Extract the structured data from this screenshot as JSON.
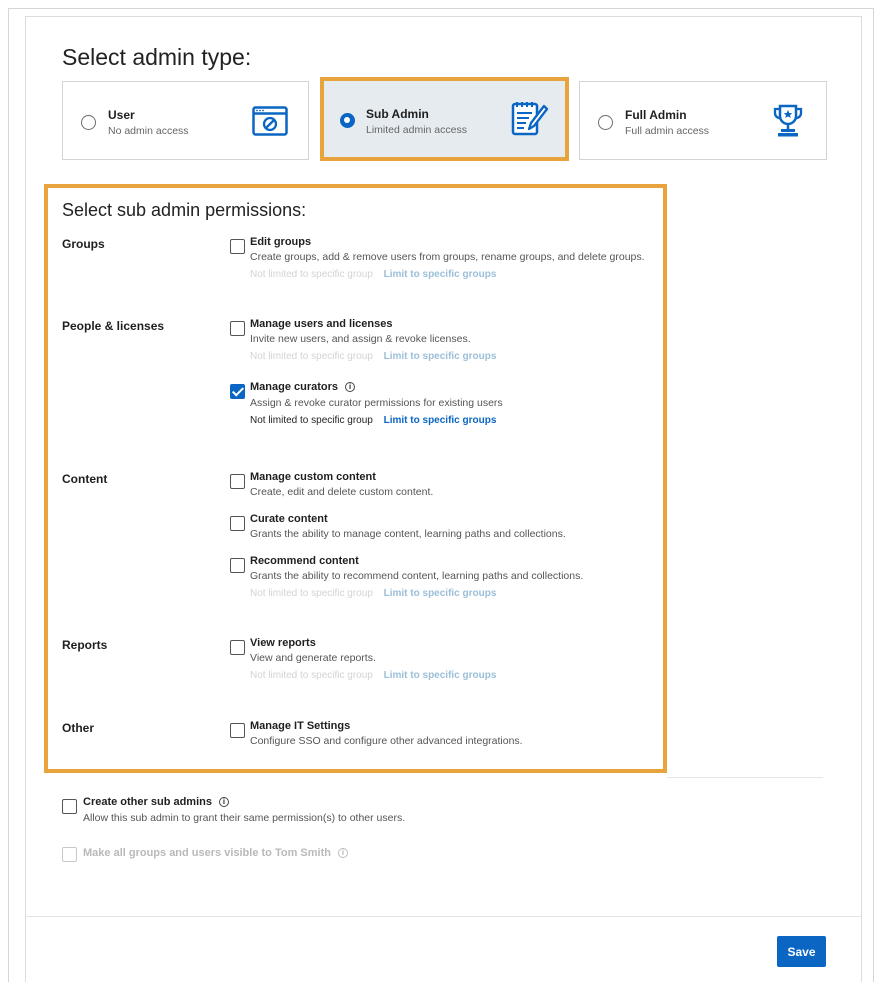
{
  "admin_type": {
    "heading": "Select admin type:",
    "options": [
      {
        "title": "User",
        "subtitle": "No admin access",
        "icon": "browser-blocked-icon",
        "selected": false
      },
      {
        "title": "Sub Admin",
        "subtitle": "Limited admin access",
        "icon": "notepad-edit-icon",
        "selected": true
      },
      {
        "title": "Full Admin",
        "subtitle": "Full admin access",
        "icon": "trophy-icon",
        "selected": false
      }
    ]
  },
  "permissions": {
    "heading": "Select sub admin permissions:",
    "sections": {
      "groups": "Groups",
      "people": "People & licenses",
      "content": "Content",
      "reports": "Reports",
      "other": "Other"
    },
    "items": {
      "edit_groups": {
        "title": "Edit groups",
        "desc": "Create groups, add & remove users from groups, rename groups, and delete groups.",
        "checked": false
      },
      "manage_users": {
        "title": "Manage users and licenses",
        "desc": "Invite new users, and assign & revoke licenses.",
        "checked": false
      },
      "manage_curators": {
        "title": "Manage curators",
        "desc": "Assign & revoke curator permissions for existing users",
        "checked": true
      },
      "manage_custom": {
        "title": "Manage custom content",
        "desc": "Create, edit and delete custom content.",
        "checked": false
      },
      "curate_content": {
        "title": "Curate content",
        "desc": "Grants the ability to manage content, learning paths and collections.",
        "checked": false
      },
      "recommend_content": {
        "title": "Recommend content",
        "desc": "Grants the ability to recommend content, learning paths and collections.",
        "checked": false
      },
      "view_reports": {
        "title": "View reports",
        "desc": "View and generate reports.",
        "checked": false
      },
      "manage_it": {
        "title": "Manage IT Settings",
        "desc": "Configure SSO and configure other advanced integrations.",
        "checked": false
      }
    },
    "scope_text": "Not limited to specific group",
    "scope_link": "Limit to specific groups"
  },
  "extras": {
    "create_sub_admins": {
      "title": "Create other sub admins",
      "desc": "Allow this sub admin to grant their same permission(s) to other users.",
      "checked": false
    },
    "visible_all": {
      "title": "Make all groups and users visible to Tom Smith",
      "checked": false,
      "disabled": true
    }
  },
  "footer": {
    "save_label": "Save"
  },
  "colors": {
    "accent": "#0a66c2",
    "highlight": "#e8a33c",
    "selected_bg": "#e6ebef"
  }
}
